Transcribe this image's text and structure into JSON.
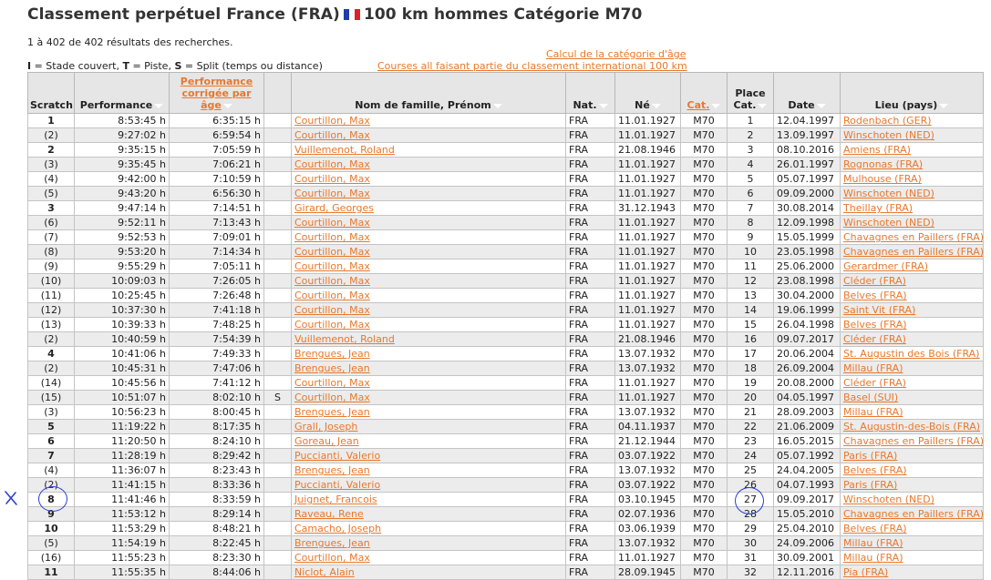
{
  "header": {
    "title_part1": "Classement perpétuel France (FRA)",
    "title_part2": "100 km hommes Catégorie M70",
    "flag_colors": [
      "#1e3fa8",
      "#ffffff",
      "#d8232a"
    ]
  },
  "result_count": "1 à 402 de 402 résultats des recherches.",
  "legend": {
    "i_key": "I",
    "i_text": " = Stade couvert, ",
    "t_key": "T",
    "t_text": " = Piste, ",
    "s_key": "S",
    "s_text": " = Split (temps ou distance)"
  },
  "links": {
    "age_calc": "Calcul de la catégorie d'âge",
    "courses": "Courses all faisant partie du classement international 100 km"
  },
  "columns": {
    "scratch": "Scratch",
    "performance": "Performance",
    "corrected_l1": "Performance",
    "corrected_l2": "corrigée par âge",
    "split": "",
    "name": "Nom de famille, Prénom",
    "nat": "Nat.",
    "born": "Né",
    "cat": "Cat.",
    "place_l1": "Place",
    "place_l2": "Cat.",
    "date": "Date",
    "lieu": "Lieu (pays)"
  },
  "colors": {
    "accent": "#e8782c",
    "header_bg": "#e6e6e6",
    "annotation": "#2a3fd0"
  },
  "annotation_mark": "X",
  "rows": [
    {
      "scratch": "1",
      "bold": true,
      "perf": "8:53:45 h",
      "corr": "6:35:15 h",
      "split": "",
      "name": "Courtillon, Max",
      "nat": "FRA",
      "born": "11.01.1927",
      "cat": "M70",
      "place": "1",
      "date": "12.04.1997",
      "lieu": "Rodenbach (GER)"
    },
    {
      "scratch": "(2)",
      "bold": false,
      "perf": "9:27:02 h",
      "corr": "6:59:54 h",
      "split": "",
      "name": "Courtillon, Max",
      "nat": "FRA",
      "born": "11.01.1927",
      "cat": "M70",
      "place": "2",
      "date": "13.09.1997",
      "lieu": "Winschoten (NED)"
    },
    {
      "scratch": "2",
      "bold": true,
      "perf": "9:35:15 h",
      "corr": "7:05:59 h",
      "split": "",
      "name": "Vuillemenot, Roland",
      "nat": "FRA",
      "born": "21.08.1946",
      "cat": "M70",
      "place": "3",
      "date": "08.10.2016",
      "lieu": "Amiens (FRA)"
    },
    {
      "scratch": "(3)",
      "bold": false,
      "perf": "9:35:45 h",
      "corr": "7:06:21 h",
      "split": "",
      "name": "Courtillon, Max",
      "nat": "FRA",
      "born": "11.01.1927",
      "cat": "M70",
      "place": "4",
      "date": "26.01.1997",
      "lieu": "Rognonas (FRA)"
    },
    {
      "scratch": "(4)",
      "bold": false,
      "perf": "9:42:00 h",
      "corr": "7:10:59 h",
      "split": "",
      "name": "Courtillon, Max",
      "nat": "FRA",
      "born": "11.01.1927",
      "cat": "M70",
      "place": "5",
      "date": "05.07.1997",
      "lieu": "Mulhouse (FRA)"
    },
    {
      "scratch": "(5)",
      "bold": false,
      "perf": "9:43:20 h",
      "corr": "6:56:30 h",
      "split": "",
      "name": "Courtillon, Max",
      "nat": "FRA",
      "born": "11.01.1927",
      "cat": "M70",
      "place": "6",
      "date": "09.09.2000",
      "lieu": "Winschoten (NED)"
    },
    {
      "scratch": "3",
      "bold": true,
      "perf": "9:47:14 h",
      "corr": "7:14:51 h",
      "split": "",
      "name": "Girard, Georges",
      "nat": "FRA",
      "born": "31.12.1943",
      "cat": "M70",
      "place": "7",
      "date": "30.08.2014",
      "lieu": "Theillay (FRA)"
    },
    {
      "scratch": "(6)",
      "bold": false,
      "perf": "9:52:11 h",
      "corr": "7:13:43 h",
      "split": "",
      "name": "Courtillon, Max",
      "nat": "FRA",
      "born": "11.01.1927",
      "cat": "M70",
      "place": "8",
      "date": "12.09.1998",
      "lieu": "Winschoten (NED)"
    },
    {
      "scratch": "(7)",
      "bold": false,
      "perf": "9:52:53 h",
      "corr": "7:09:01 h",
      "split": "",
      "name": "Courtillon, Max",
      "nat": "FRA",
      "born": "11.01.1927",
      "cat": "M70",
      "place": "9",
      "date": "15.05.1999",
      "lieu": "Chavagnes en Paillers (FRA)"
    },
    {
      "scratch": "(8)",
      "bold": false,
      "perf": "9:53:20 h",
      "corr": "7:14:34 h",
      "split": "",
      "name": "Courtillon, Max",
      "nat": "FRA",
      "born": "11.01.1927",
      "cat": "M70",
      "place": "10",
      "date": "23.05.1998",
      "lieu": "Chavagnes en Paillers (FRA)"
    },
    {
      "scratch": "(9)",
      "bold": false,
      "perf": "9:55:29 h",
      "corr": "7:05:11 h",
      "split": "",
      "name": "Courtillon, Max",
      "nat": "FRA",
      "born": "11.01.1927",
      "cat": "M70",
      "place": "11",
      "date": "25.06.2000",
      "lieu": "Gerardmer (FRA)"
    },
    {
      "scratch": "(10)",
      "bold": false,
      "perf": "10:09:03 h",
      "corr": "7:26:05 h",
      "split": "",
      "name": "Courtillon, Max",
      "nat": "FRA",
      "born": "11.01.1927",
      "cat": "M70",
      "place": "12",
      "date": "23.08.1998",
      "lieu": "Cléder (FRA)"
    },
    {
      "scratch": "(11)",
      "bold": false,
      "perf": "10:25:45 h",
      "corr": "7:26:48 h",
      "split": "",
      "name": "Courtillon, Max",
      "nat": "FRA",
      "born": "11.01.1927",
      "cat": "M70",
      "place": "13",
      "date": "30.04.2000",
      "lieu": "Belves (FRA)"
    },
    {
      "scratch": "(12)",
      "bold": false,
      "perf": "10:37:30 h",
      "corr": "7:41:18 h",
      "split": "",
      "name": "Courtillon, Max",
      "nat": "FRA",
      "born": "11.01.1927",
      "cat": "M70",
      "place": "14",
      "date": "19.06.1999",
      "lieu": "Saint Vit (FRA)"
    },
    {
      "scratch": "(13)",
      "bold": false,
      "perf": "10:39:33 h",
      "corr": "7:48:25 h",
      "split": "",
      "name": "Courtillon, Max",
      "nat": "FRA",
      "born": "11.01.1927",
      "cat": "M70",
      "place": "15",
      "date": "26.04.1998",
      "lieu": "Belves (FRA)"
    },
    {
      "scratch": "(2)",
      "bold": false,
      "perf": "10:40:59 h",
      "corr": "7:54:39 h",
      "split": "",
      "name": "Vuillemenot, Roland",
      "nat": "FRA",
      "born": "21.08.1946",
      "cat": "M70",
      "place": "16",
      "date": "09.07.2017",
      "lieu": "Cléder (FRA)"
    },
    {
      "scratch": "4",
      "bold": true,
      "perf": "10:41:06 h",
      "corr": "7:49:33 h",
      "split": "",
      "name": "Brengues, Jean",
      "nat": "FRA",
      "born": "13.07.1932",
      "cat": "M70",
      "place": "17",
      "date": "20.06.2004",
      "lieu": "St. Augustin des Bois (FRA)"
    },
    {
      "scratch": "(2)",
      "bold": false,
      "perf": "10:45:31 h",
      "corr": "7:47:06 h",
      "split": "",
      "name": "Brengues, Jean",
      "nat": "FRA",
      "born": "13.07.1932",
      "cat": "M70",
      "place": "18",
      "date": "26.09.2004",
      "lieu": "Millau (FRA)"
    },
    {
      "scratch": "(14)",
      "bold": false,
      "perf": "10:45:56 h",
      "corr": "7:41:12 h",
      "split": "",
      "name": "Courtillon, Max",
      "nat": "FRA",
      "born": "11.01.1927",
      "cat": "M70",
      "place": "19",
      "date": "20.08.2000",
      "lieu": "Cléder (FRA)"
    },
    {
      "scratch": "(15)",
      "bold": false,
      "perf": "10:51:07 h",
      "corr": "8:02:10 h",
      "split": "S",
      "name": "Courtillon, Max",
      "nat": "FRA",
      "born": "11.01.1927",
      "cat": "M70",
      "place": "20",
      "date": "04.05.1997",
      "lieu": "Basel (SUI)"
    },
    {
      "scratch": "(3)",
      "bold": false,
      "perf": "10:56:23 h",
      "corr": "8:00:45 h",
      "split": "",
      "name": "Brengues, Jean",
      "nat": "FRA",
      "born": "13.07.1932",
      "cat": "M70",
      "place": "21",
      "date": "28.09.2003",
      "lieu": "Millau (FRA)"
    },
    {
      "scratch": "5",
      "bold": true,
      "perf": "11:19:22 h",
      "corr": "8:17:35 h",
      "split": "",
      "name": "Grall, Joseph",
      "nat": "FRA",
      "born": "04.11.1937",
      "cat": "M70",
      "place": "22",
      "date": "21.06.2009",
      "lieu": "St. Augustin-des-Bois (FRA)"
    },
    {
      "scratch": "6",
      "bold": true,
      "perf": "11:20:50 h",
      "corr": "8:24:10 h",
      "split": "",
      "name": "Goreau, Jean",
      "nat": "FRA",
      "born": "21.12.1944",
      "cat": "M70",
      "place": "23",
      "date": "16.05.2015",
      "lieu": "Chavagnes en Paillers (FRA)"
    },
    {
      "scratch": "7",
      "bold": true,
      "perf": "11:28:19 h",
      "corr": "8:29:42 h",
      "split": "",
      "name": "Puccianti, Valerio",
      "nat": "FRA",
      "born": "03.07.1922",
      "cat": "M70",
      "place": "24",
      "date": "05.07.1992",
      "lieu": "Paris (FRA)"
    },
    {
      "scratch": "(4)",
      "bold": false,
      "perf": "11:36:07 h",
      "corr": "8:23:43 h",
      "split": "",
      "name": "Brengues, Jean",
      "nat": "FRA",
      "born": "13.07.1932",
      "cat": "M70",
      "place": "25",
      "date": "24.04.2005",
      "lieu": "Belves (FRA)"
    },
    {
      "scratch": "(2)",
      "bold": false,
      "perf": "11:41:15 h",
      "corr": "8:33:36 h",
      "split": "",
      "name": "Puccianti, Valerio",
      "nat": "FRA",
      "born": "03.07.1922",
      "cat": "M70",
      "place": "26",
      "date": "04.07.1993",
      "lieu": "Paris (FRA)"
    },
    {
      "scratch": "8",
      "bold": true,
      "perf": "11:41:46 h",
      "corr": "8:33:59 h",
      "split": "",
      "name": "Juignet, Francois",
      "nat": "FRA",
      "born": "03.10.1945",
      "cat": "M70",
      "place": "27",
      "date": "09.09.2017",
      "lieu": "Winschoten (NED)"
    },
    {
      "scratch": "9",
      "bold": true,
      "perf": "11:53:12 h",
      "corr": "8:29:14 h",
      "split": "",
      "name": "Raveau, Rene",
      "nat": "FRA",
      "born": "02.07.1936",
      "cat": "M70",
      "place": "28",
      "date": "15.05.2010",
      "lieu": "Chavagnes en Paillers (FRA)"
    },
    {
      "scratch": "10",
      "bold": true,
      "perf": "11:53:29 h",
      "corr": "8:48:21 h",
      "split": "",
      "name": "Camacho, Joseph",
      "nat": "FRA",
      "born": "03.06.1939",
      "cat": "M70",
      "place": "29",
      "date": "25.04.2010",
      "lieu": "Belves (FRA)"
    },
    {
      "scratch": "(5)",
      "bold": false,
      "perf": "11:54:19 h",
      "corr": "8:22:45 h",
      "split": "",
      "name": "Brengues, Jean",
      "nat": "FRA",
      "born": "13.07.1932",
      "cat": "M70",
      "place": "30",
      "date": "24.09.2006",
      "lieu": "Millau (FRA)"
    },
    {
      "scratch": "(16)",
      "bold": false,
      "perf": "11:55:23 h",
      "corr": "8:23:30 h",
      "split": "",
      "name": "Courtillon, Max",
      "nat": "FRA",
      "born": "11.01.1927",
      "cat": "M70",
      "place": "31",
      "date": "30.09.2001",
      "lieu": "Millau (FRA)"
    },
    {
      "scratch": "11",
      "bold": true,
      "perf": "11:55:35 h",
      "corr": "8:44:06 h",
      "split": "",
      "name": "Niclot, Alain",
      "nat": "FRA",
      "born": "28.09.1945",
      "cat": "M70",
      "place": "32",
      "date": "12.11.2016",
      "lieu": "Pia (FRA)"
    }
  ]
}
